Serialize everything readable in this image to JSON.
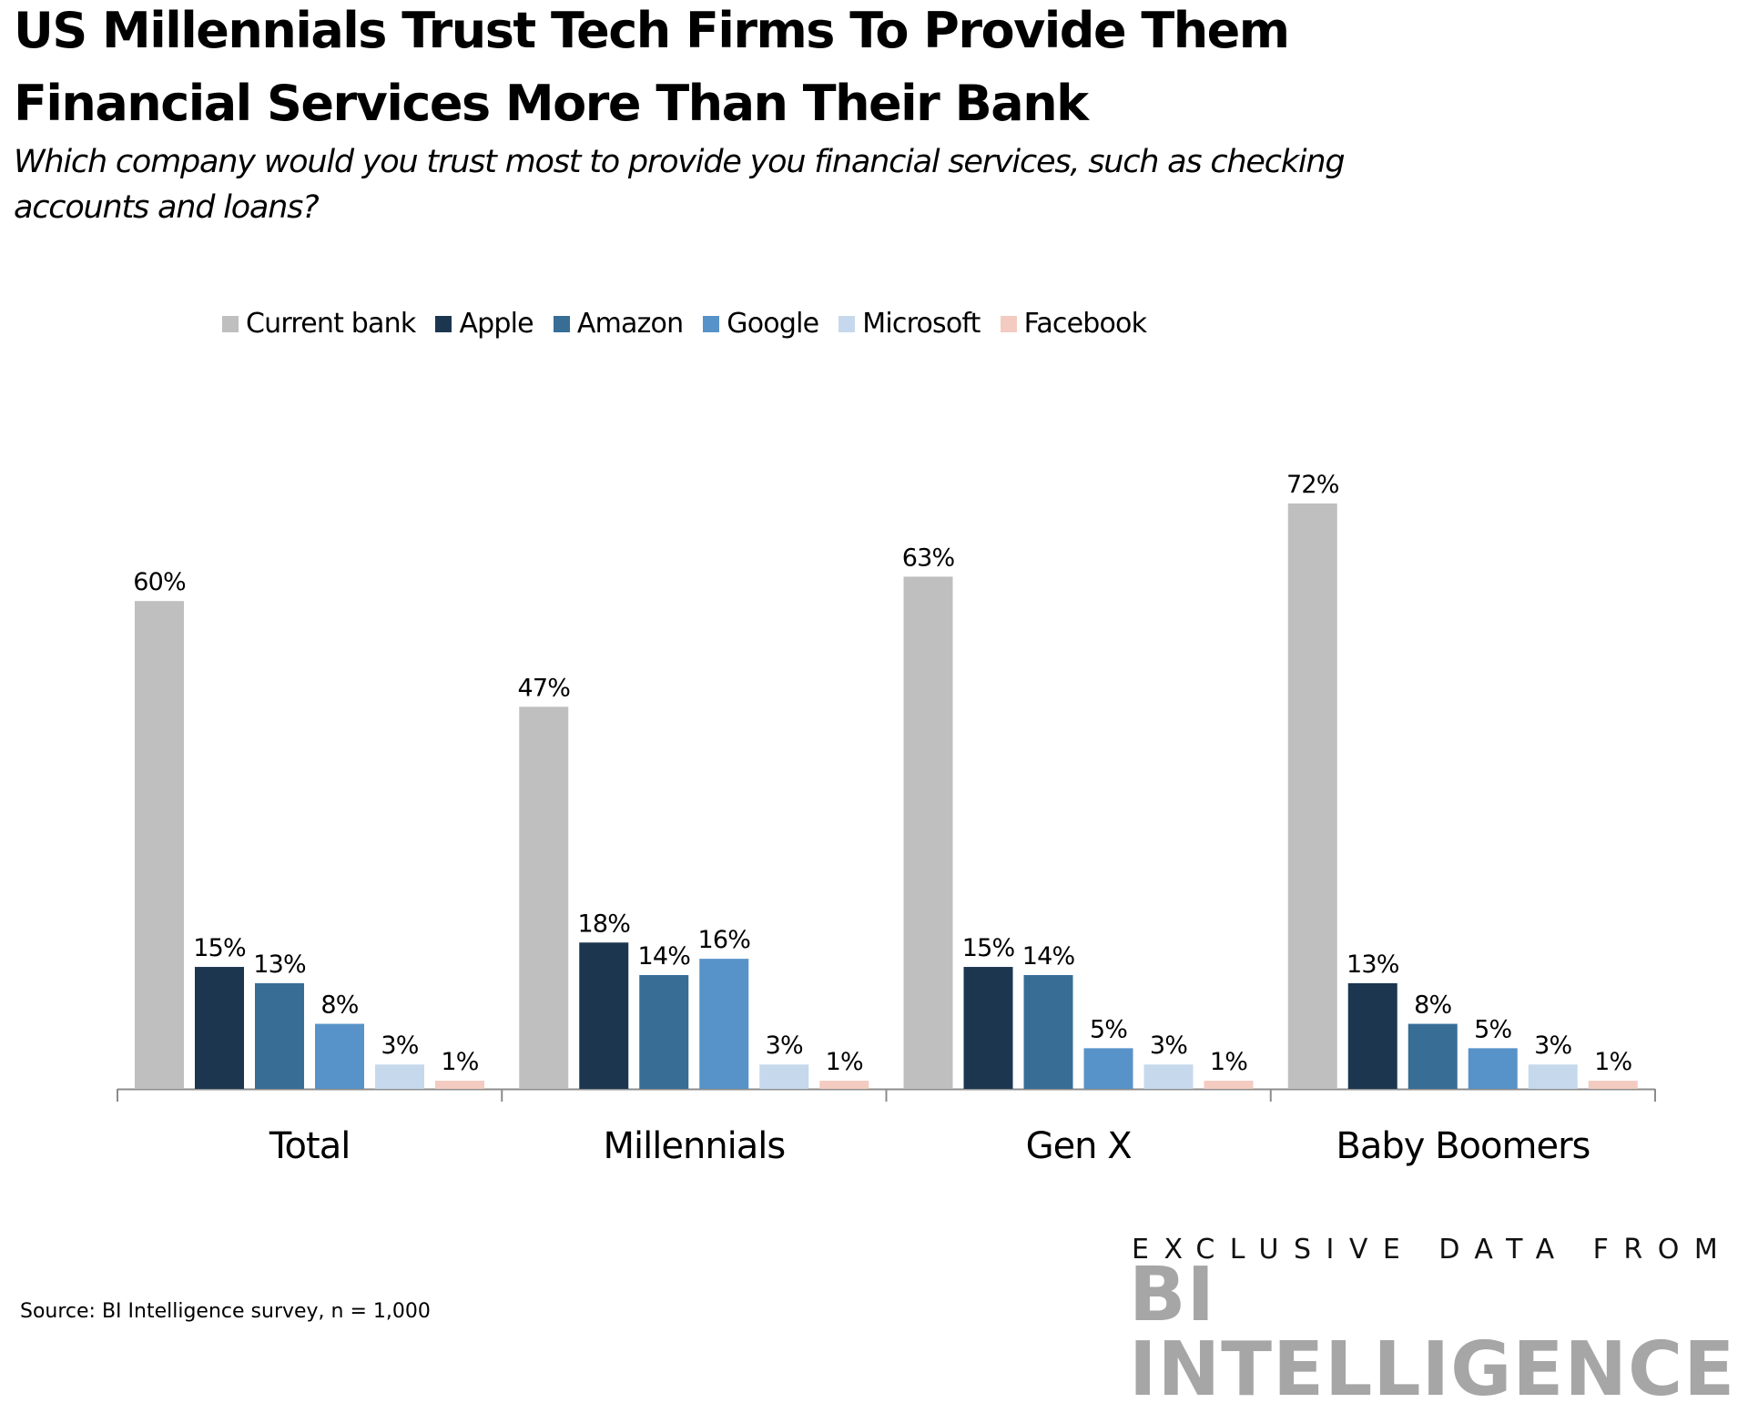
{
  "header": {
    "title_line1": "US Millennials Trust Tech Firms To Provide Them",
    "title_line2": "Financial Services More Than Their Bank",
    "subtitle_line1": "Which company would you trust most to provide you financial services, such as checking",
    "subtitle_line2": "accounts and loans?"
  },
  "footer": {
    "source": "Source: BI Intelligence survey, n = 1,000",
    "brand_tagline": "EXCLUSIVE DATA FROM",
    "brand_name": "BI INTELLIGENCE"
  },
  "chart_data": {
    "type": "bar",
    "title": "US Millennials Trust Tech Firms To Provide Them Financial Services More Than Their Bank",
    "subtitle": "Which company would you trust most to provide you financial services, such as checking accounts and loans?",
    "xlabel": "",
    "ylabel": "",
    "ylim": [
      0,
      72
    ],
    "grid": false,
    "legend_position": "top",
    "value_format": "percent",
    "categories": [
      "Total",
      "Millennials",
      "Gen X",
      "Baby Boomers"
    ],
    "series": [
      {
        "name": "Current bank",
        "color": "#bfbfbf",
        "values": [
          60,
          47,
          63,
          72
        ]
      },
      {
        "name": "Apple",
        "color": "#1c3650",
        "values": [
          15,
          18,
          15,
          13
        ]
      },
      {
        "name": "Amazon",
        "color": "#386d96",
        "values": [
          13,
          14,
          14,
          8
        ]
      },
      {
        "name": "Google",
        "color": "#5793c8",
        "values": [
          8,
          16,
          5,
          5
        ]
      },
      {
        "name": "Microsoft",
        "color": "#c6d9ec",
        "values": [
          3,
          3,
          3,
          3
        ]
      },
      {
        "name": "Facebook",
        "color": "#f4cbc0",
        "values": [
          1,
          1,
          1,
          1
        ]
      }
    ]
  }
}
